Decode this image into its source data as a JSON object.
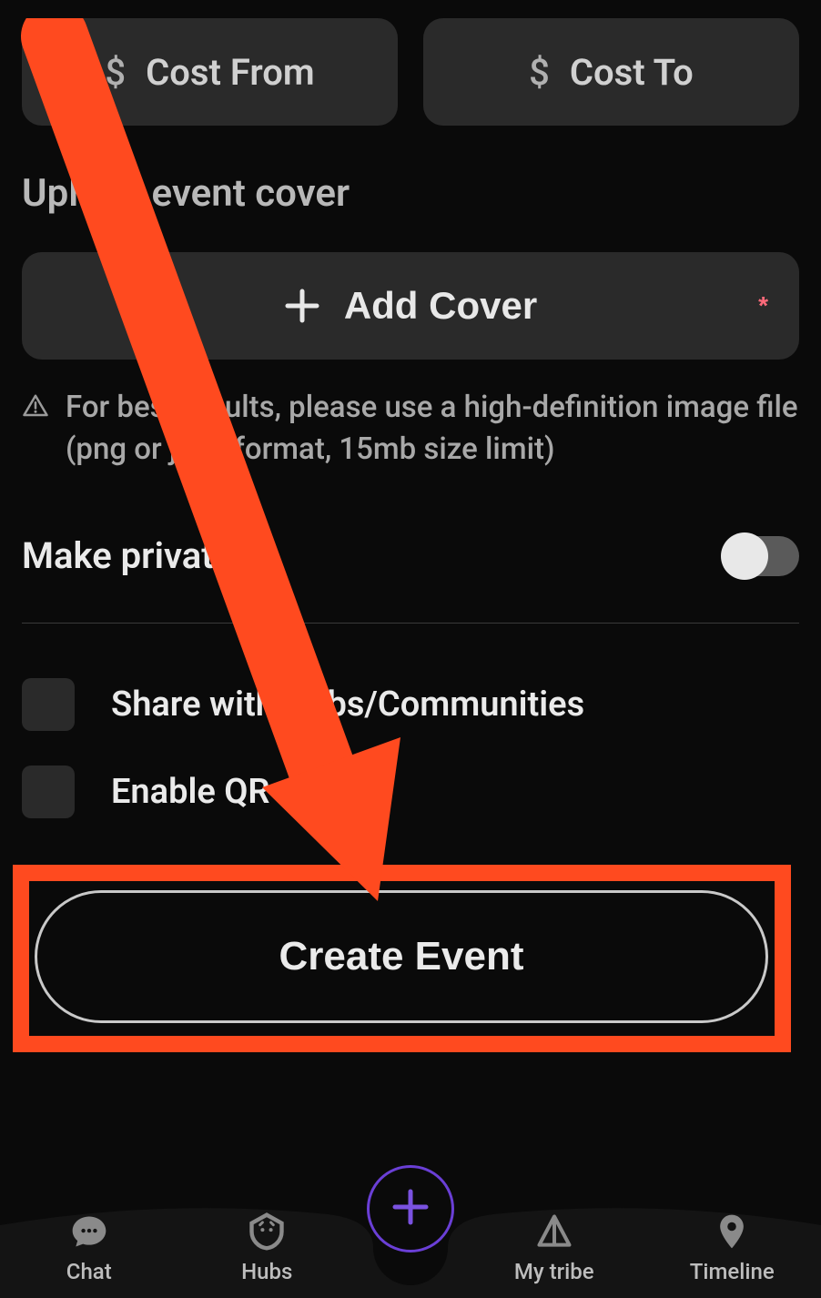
{
  "cost": {
    "currency": "$",
    "from_placeholder": "Cost From",
    "to_placeholder": "Cost To"
  },
  "upload": {
    "section_title": "Upload event cover",
    "add_cover_label": "Add Cover",
    "required_mark": "*",
    "hint": "For best results, please use a high-definition image file (png or jpeg format, 15mb size limit)"
  },
  "private": {
    "label": "Make private",
    "value": false
  },
  "options": {
    "share_label": "Share with Hubs/Communities",
    "qr_label": "Enable QR Access"
  },
  "create_button": "Create Event",
  "nav": {
    "chat": "Chat",
    "hubs": "Hubs",
    "mytribe": "My tribe",
    "timeline": "Timeline"
  },
  "annotation": {
    "type": "arrow+box",
    "color": "#ff4a1f",
    "target": "create-event-button"
  }
}
